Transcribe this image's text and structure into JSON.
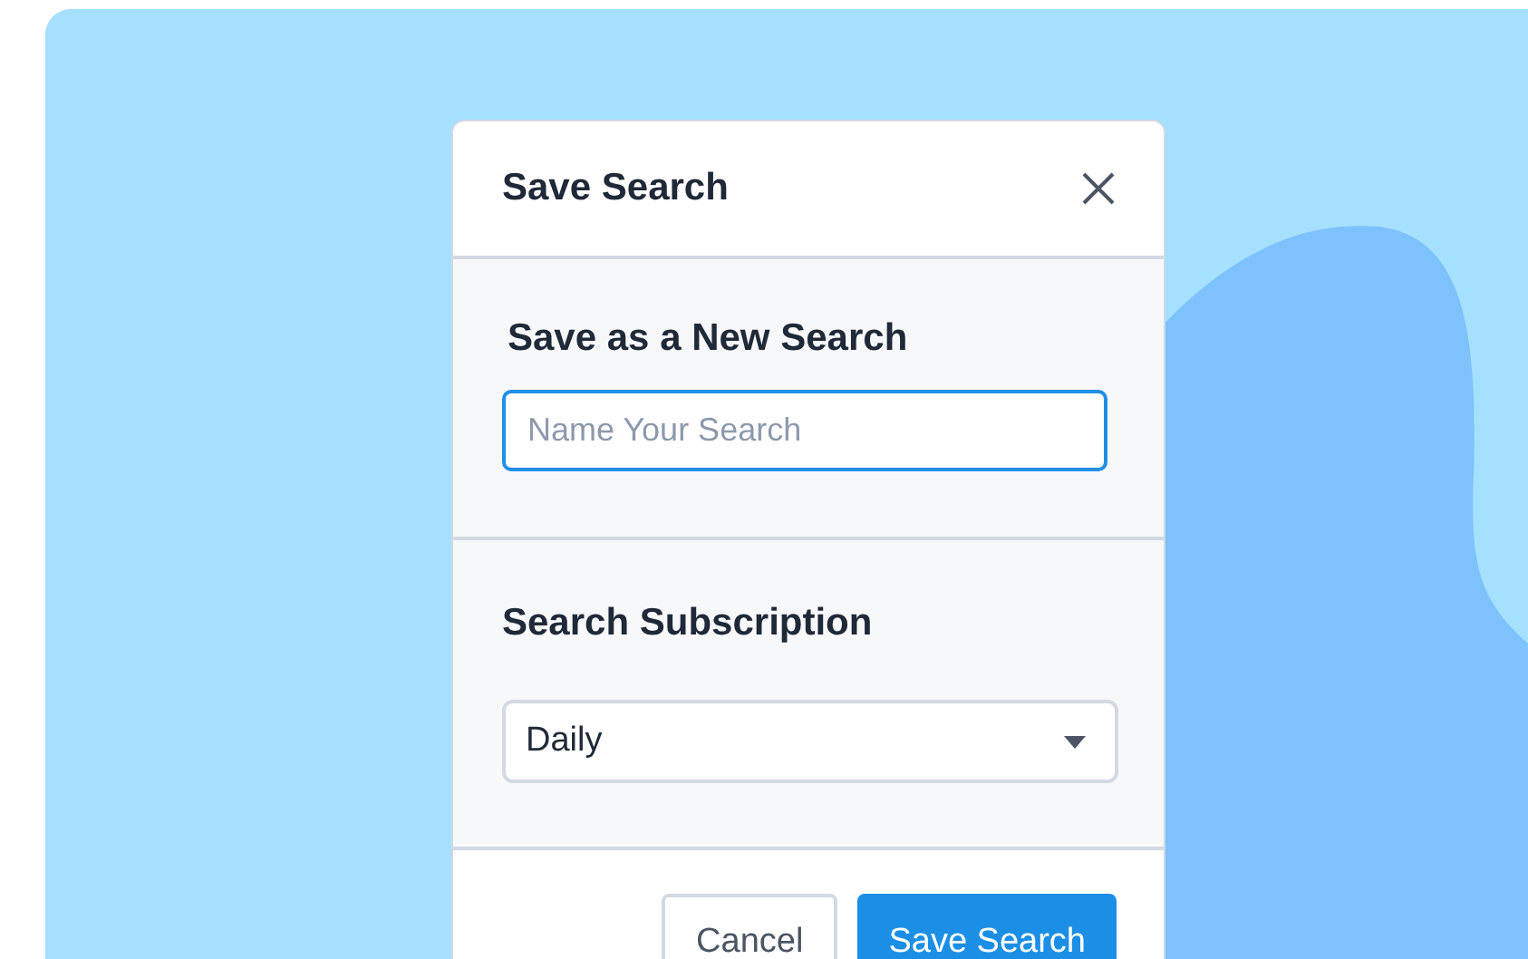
{
  "dialog": {
    "title": "Save Search",
    "new_search": {
      "label": "Save as a New Search",
      "placeholder": "Name Your Search",
      "focused": true
    },
    "subscription": {
      "label": "Search Subscription",
      "value": "Daily"
    },
    "buttons": [
      {
        "label": "Cancel",
        "kind": "secondary"
      },
      {
        "label": "Save Search",
        "kind": "primary"
      }
    ]
  }
}
